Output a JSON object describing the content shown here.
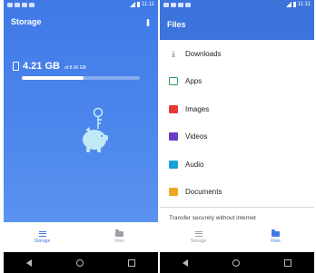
{
  "colors": {
    "primary_blue": "#3f79e6",
    "files_header": "#3c74dc",
    "progress_track": "#7fa6f0"
  },
  "left": {
    "status_time": "11:11",
    "title": "Storage",
    "menu_icon": "more-vert-icon",
    "usage": {
      "used": "4.21 GB",
      "total": "of 8.00 GB",
      "fraction": 0.526
    },
    "illustration": "piggy-bank-icon",
    "nav": [
      {
        "label": "Storage",
        "icon": "storage-list-icon",
        "active": true
      },
      {
        "label": "Files",
        "icon": "folder-icon",
        "active": false
      }
    ]
  },
  "right": {
    "status_time": "11:11",
    "title": "Files",
    "items": [
      {
        "label": "Downloads",
        "icon": "download-icon"
      },
      {
        "label": "Apps",
        "icon": "apps-icon"
      },
      {
        "label": "Images",
        "icon": "image-icon"
      },
      {
        "label": "Videos",
        "icon": "video-icon"
      },
      {
        "label": "Audio",
        "icon": "audio-icon"
      },
      {
        "label": "Documents",
        "icon": "document-icon"
      }
    ],
    "transfer_text": "Transfer securely without internet",
    "nav": [
      {
        "label": "Storage",
        "icon": "storage-list-icon",
        "active": false
      },
      {
        "label": "Files",
        "icon": "folder-icon",
        "active": true
      }
    ]
  }
}
